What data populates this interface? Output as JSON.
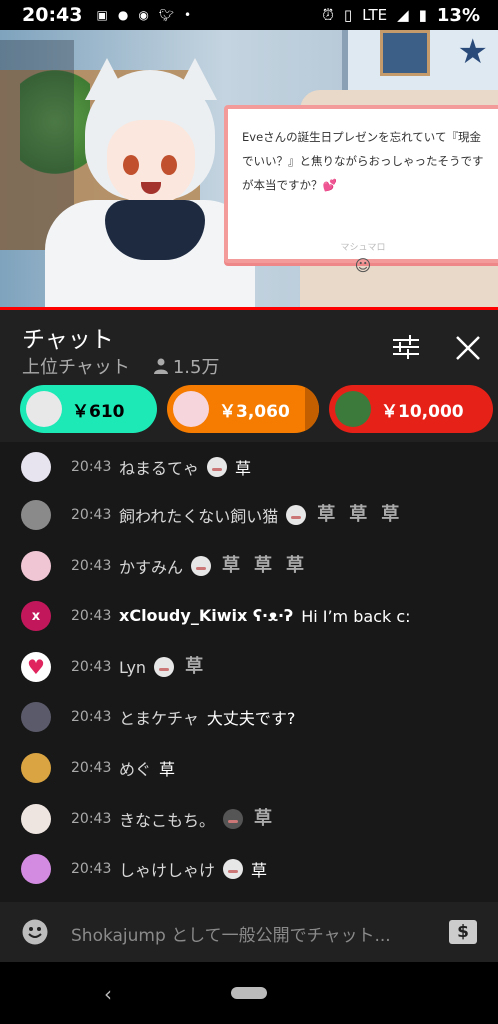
{
  "status": {
    "time": "20:43",
    "network": "LTE",
    "battery": "13%",
    "notification_icons": [
      "image-icon",
      "line-icon",
      "spoon-icon",
      "twitter-icon",
      "dot-icon"
    ]
  },
  "video": {
    "card_message": "Eveさんの誕生日プレゼンを忘れていて『現金でいい？』と焦りながらおっしゃったそうですが本当ですか？",
    "card_signature": "マシュマロ"
  },
  "chat_header": {
    "title": "チャット",
    "mode": "上位チャット",
    "viewers": "1.5万"
  },
  "super_chats": [
    {
      "amount": "￥610",
      "color": "#1de9b6"
    },
    {
      "amount": "￥3,060",
      "color": "#f57c00"
    },
    {
      "amount": "￥10,000",
      "color": "#e62117"
    },
    {
      "amount": "￥",
      "color": "#d00000"
    }
  ],
  "messages": [
    {
      "time": "20:43",
      "name": "ねまるてゃ",
      "text": "草"
    },
    {
      "time": "20:43",
      "name": "飼われたくない飼い猫",
      "text": ""
    },
    {
      "time": "20:43",
      "name": "かすみん",
      "text": ""
    },
    {
      "time": "20:43",
      "name": "xCloudy_Kiwix ʕ·ᴥ·ʔ",
      "text": "Hi I’m back c:"
    },
    {
      "time": "20:43",
      "name": "Lyn",
      "text": ""
    },
    {
      "time": "20:43",
      "name": "とまケチャ",
      "text": "大丈夫です?"
    },
    {
      "time": "20:43",
      "name": "めぐ",
      "text": "草"
    },
    {
      "time": "20:43",
      "name": "きなこもち。",
      "text": ""
    },
    {
      "time": "20:43",
      "name": "しゃけしゃけ",
      "text": "草"
    }
  ],
  "avatar_letters": {
    "xcloudy": "x"
  },
  "input": {
    "placeholder": "Shokajump として一般公開でチャット..."
  }
}
